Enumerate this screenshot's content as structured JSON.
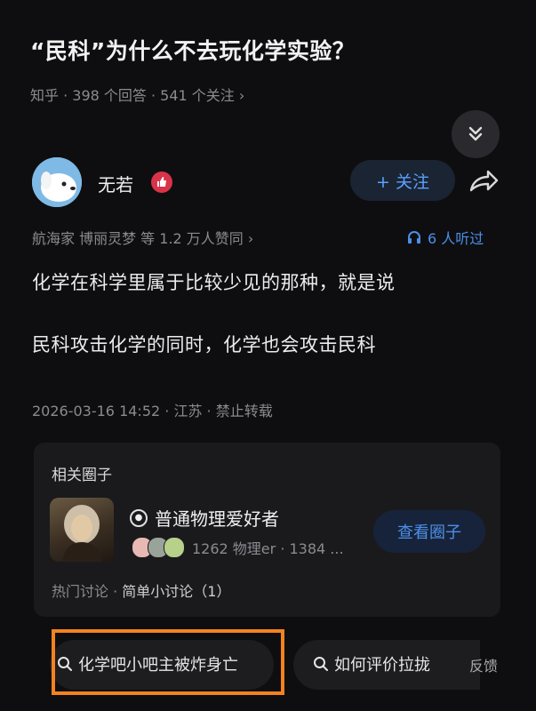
{
  "question": {
    "title": "“民科”为什么不去玩化学实验？",
    "meta": "知乎 · 398 个回答 · 541 个关注 ›"
  },
  "author": {
    "name": "无若",
    "badge_icon": "thumb-badge-icon",
    "follow_label": "+ 关注"
  },
  "votes": "航海家 博丽灵梦 等 1.2 万人赞同 ›",
  "listeners": "6 人听过",
  "answer": {
    "paragraphs": [
      "化学在科学里属于比较少见的那种，就是说",
      "民科攻击化学的同时，化学也会攻击民科"
    ],
    "date_line": "2026-03-16 14:52 · 江苏 · 禁止转载"
  },
  "related_circle": {
    "heading": "相关圈子",
    "name": "普通物理爱好者",
    "stats": "1262 物理er · 1384 ...",
    "button_label": "查看圈子",
    "hot_prefix": "热门讨论 · ",
    "hot_topic": "简单小讨论（1）"
  },
  "suggested_searches": [
    "化学吧小吧主被炸身亡",
    "如何评价拉拢"
  ],
  "feedback_label": "反馈",
  "colors": {
    "background": "#0e0e10",
    "accent_blue": "#4c8fe8",
    "highlight_orange": "#f58220"
  }
}
